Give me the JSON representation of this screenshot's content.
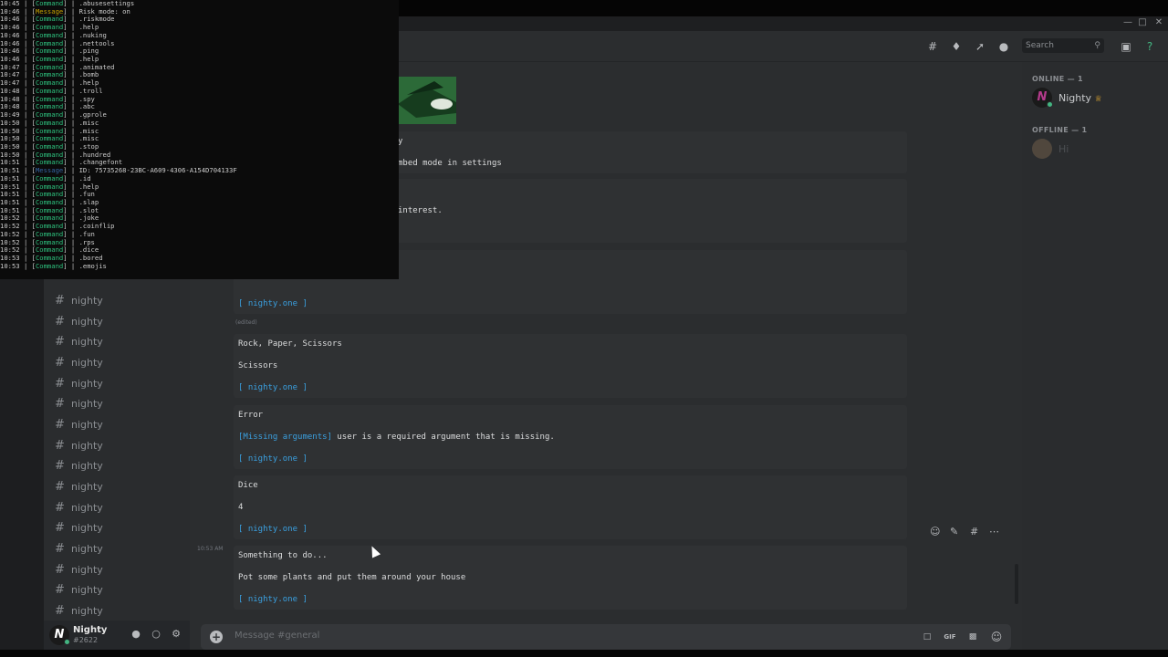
{
  "colors": {
    "accent_link": "#3aa0e0",
    "online": "#43b581",
    "console_cmd": "#2ec27e",
    "console_msg": "#c4a000"
  },
  "console": {
    "rows": [
      {
        "time": "10:45",
        "tag": "Command",
        "text": ".abusesettings"
      },
      {
        "time": "10:46",
        "tag": "Message",
        "text": "Risk mode: on"
      },
      {
        "time": "10:46",
        "tag": "Command",
        "text": ".riskmode"
      },
      {
        "time": "10:46",
        "tag": "Command",
        "text": ".help"
      },
      {
        "time": "10:46",
        "tag": "Command",
        "text": ".nuking"
      },
      {
        "time": "10:46",
        "tag": "Command",
        "text": ".nettools"
      },
      {
        "time": "10:46",
        "tag": "Command",
        "text": ".ping"
      },
      {
        "time": "10:46",
        "tag": "Command",
        "text": ".help"
      },
      {
        "time": "10:47",
        "tag": "Command",
        "text": ".animated"
      },
      {
        "time": "10:47",
        "tag": "Command",
        "text": ".bomb"
      },
      {
        "time": "10:47",
        "tag": "Command",
        "text": ".help"
      },
      {
        "time": "10:48",
        "tag": "Command",
        "text": ".troll"
      },
      {
        "time": "10:48",
        "tag": "Command",
        "text": ".spy"
      },
      {
        "time": "10:48",
        "tag": "Command",
        "text": ".abc"
      },
      {
        "time": "10:49",
        "tag": "Command",
        "text": ".gprole"
      },
      {
        "time": "10:50",
        "tag": "Command",
        "text": ".misc"
      },
      {
        "time": "10:50",
        "tag": "Command",
        "text": ".misc"
      },
      {
        "time": "10:50",
        "tag": "Command",
        "text": ".misc"
      },
      {
        "time": "10:50",
        "tag": "Command",
        "text": ".stop"
      },
      {
        "time": "10:50",
        "tag": "Command",
        "text": ".hundred"
      },
      {
        "time": "10:51",
        "tag": "Command",
        "text": ".changefont"
      },
      {
        "time": "10:51",
        "tag": "Message",
        "text": "ID: 75735268-23BC-A609-4306-A154D704133F"
      },
      {
        "time": "10:51",
        "tag": "Command",
        "text": ".id"
      },
      {
        "time": "10:51",
        "tag": "Command",
        "text": ".help"
      },
      {
        "time": "10:51",
        "tag": "Command",
        "text": ".fun"
      },
      {
        "time": "10:51",
        "tag": "Command",
        "text": ".slap"
      },
      {
        "time": "10:51",
        "tag": "Command",
        "text": ".slot"
      },
      {
        "time": "10:52",
        "tag": "Command",
        "text": ".joke"
      },
      {
        "time": "10:52",
        "tag": "Command",
        "text": ".coinflip"
      },
      {
        "time": "10:52",
        "tag": "Command",
        "text": ".fun"
      },
      {
        "time": "10:52",
        "tag": "Command",
        "text": ".rps"
      },
      {
        "time": "10:52",
        "tag": "Command",
        "text": ".dice"
      },
      {
        "time": "10:53",
        "tag": "Command",
        "text": ".bored"
      },
      {
        "time": "10:53",
        "tag": "Command",
        "text": ".emojis"
      }
    ]
  },
  "channels": {
    "items": [
      "nighty",
      "nighty",
      "nighty",
      "nighty",
      "nighty",
      "nighty",
      "nighty",
      "nighty",
      "nighty",
      "nighty",
      "nighty",
      "nighty",
      "nighty",
      "nighty",
      "nighty",
      "nighty",
      "nighty"
    ]
  },
  "user_panel": {
    "avatar_letter": "N",
    "name": "Nighty",
    "tag": "#2622"
  },
  "header": {
    "search_placeholder": "Search"
  },
  "chat": {
    "partial_1": "y",
    "partial_2": "mbed mode in settings",
    "partial_3": "interest.",
    "footer_link": "[ nighty.one ]",
    "edited_label": "(edited)",
    "embeds": [
      {
        "title": "Rock, Paper, Scissors",
        "body": "Scissors"
      },
      {
        "title": "Error",
        "body_tag": "[Missing arguments]",
        "body": " user is a required argument that is missing."
      },
      {
        "title": "Dice",
        "body": "4"
      },
      {
        "title": "Something to do...",
        "body": "Pot some plants and put them around your house"
      }
    ],
    "last_time": "10:53 AM"
  },
  "input": {
    "placeholder": "Message #general"
  },
  "members": {
    "online_header": "ONLINE — 1",
    "offline_header": "OFFLINE — 1",
    "online_name": "Nighty",
    "offline_name": "Hi"
  }
}
